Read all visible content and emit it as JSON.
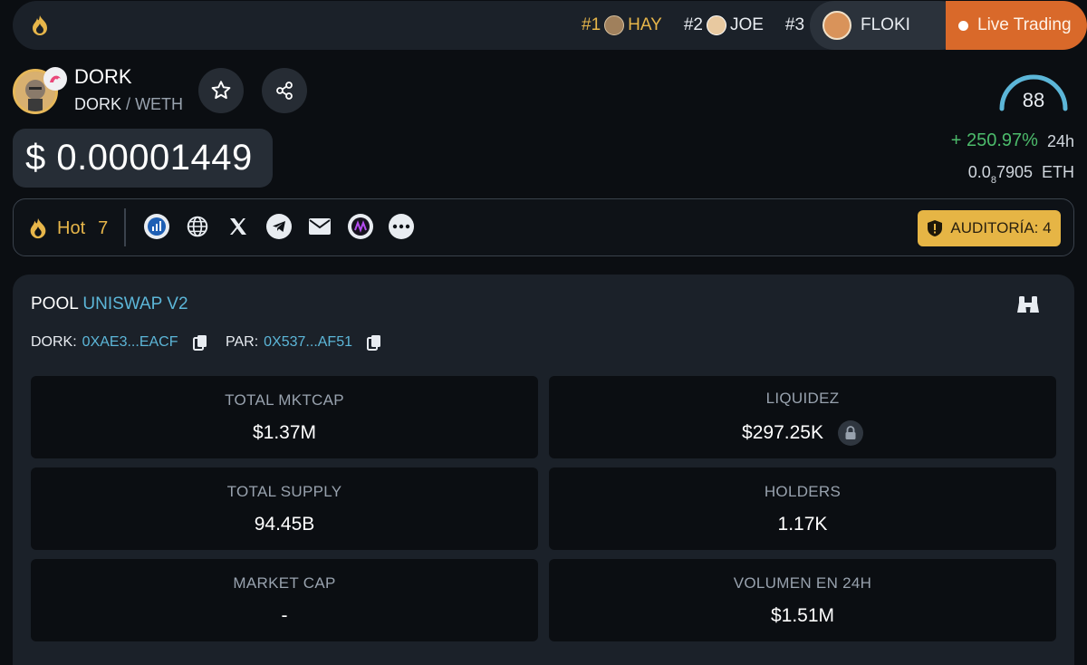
{
  "trending": [
    {
      "rank": "#1",
      "symbol": "HAY",
      "avatar_color": "#a0805c"
    },
    {
      "rank": "#2",
      "symbol": "JOE",
      "avatar_color": "#e8c9a0"
    },
    {
      "rank": "#3",
      "symbol": "FLOKI",
      "avatar_color": "#d9935a"
    }
  ],
  "live_trading_label": "Live Trading",
  "token": {
    "name": "DORK",
    "base": "DORK",
    "separator": "/",
    "quote": "WETH",
    "price": "$ 0.00001449",
    "score": "88",
    "change_pct": "+ 250.97%",
    "change_period": "24h",
    "eth_price_prefix": "0.0",
    "eth_price_zeros": "8",
    "eth_price_rest": "7905",
    "eth_unit": "ETH"
  },
  "social": {
    "hot_label": "Hot",
    "hot_count": "7",
    "icons": [
      "chart-icon",
      "globe-icon",
      "x-icon",
      "telegram-icon",
      "mail-icon",
      "app-icon",
      "more-icon"
    ],
    "audit_label": "AUDITORÍA: 4"
  },
  "pool": {
    "label": "POOL",
    "dex": "UNISWAP V2",
    "token_key": "DORK:",
    "token_addr": "0XAE3...EACF",
    "pair_key": "PAR:",
    "pair_addr": "0X537...AF51",
    "stats": [
      {
        "label": "TOTAL MKTCAP",
        "value": "$1.37M"
      },
      {
        "label": "LIQUIDEZ",
        "value": "$297.25K",
        "locked": true
      },
      {
        "label": "TOTAL SUPPLY",
        "value": "94.45B"
      },
      {
        "label": "HOLDERS",
        "value": "1.17K"
      },
      {
        "label": "MARKET CAP",
        "value": "-"
      },
      {
        "label": "VOLUMEN EN 24H",
        "value": "$1.51M"
      }
    ]
  },
  "colors": {
    "accent_gold": "#e7b64a",
    "live_orange": "#d9692a",
    "positive_green": "#4cbb6b",
    "link_blue": "#5cb6d8"
  }
}
